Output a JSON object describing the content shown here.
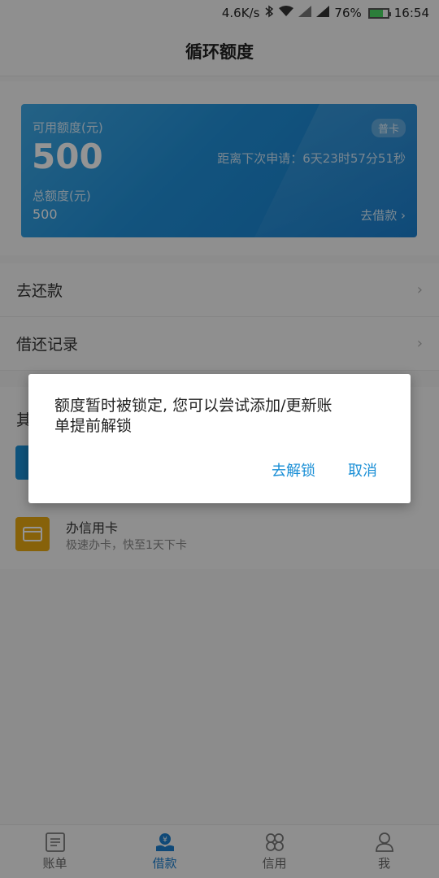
{
  "status_bar": {
    "speed": "4.6K/s",
    "battery": "76%",
    "time": "16:54"
  },
  "header": {
    "title": "循环额度"
  },
  "card": {
    "available_label": "可用额度(元)",
    "available_value": "500",
    "tier": "普卡",
    "countdown": "距离下次申请：6天23时57分51秒",
    "total_label": "总额度(元)",
    "total_value": "500",
    "borrow_link": "去借款"
  },
  "menu": [
    {
      "label": "去还款"
    },
    {
      "label": "借还记录"
    }
  ],
  "other": {
    "title": "其",
    "items": [
      {
        "title": "",
        "subtitle": ""
      },
      {
        "title": "办信用卡",
        "subtitle": "极速办卡，快至1天下卡"
      }
    ]
  },
  "dialog": {
    "message": "额度暂时被锁定, 您可以尝试添加/更新账单提前解锁",
    "unlock_label": "去解锁",
    "cancel_label": "取消"
  },
  "tabs": [
    {
      "label": "账单",
      "icon": "bill-icon",
      "active": false
    },
    {
      "label": "借款",
      "icon": "loan-icon",
      "active": true
    },
    {
      "label": "信用",
      "icon": "credit-icon",
      "active": false
    },
    {
      "label": "我",
      "icon": "profile-icon",
      "active": false
    }
  ],
  "colors": {
    "accent": "#1a7fcf",
    "card_blue": "#1f8fd8",
    "dialog_button": "#1a8fd6",
    "card_icon_yellow": "#e8a912"
  }
}
